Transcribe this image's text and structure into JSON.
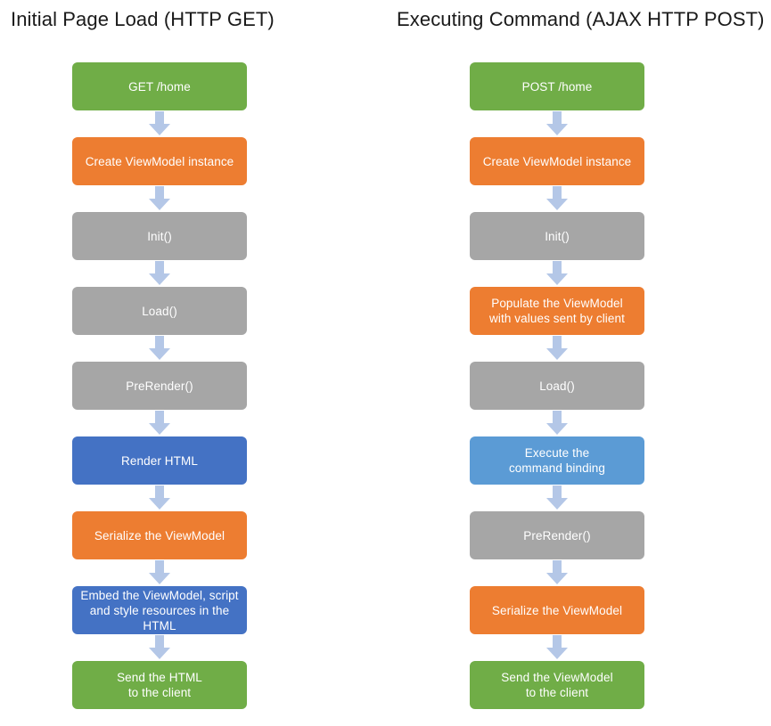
{
  "diagram": {
    "type": "flowchart",
    "orientation": "two-column vertical flow",
    "palette": {
      "green": "#70AD47",
      "orange": "#ED7D31",
      "gray": "#A6A6A6",
      "blue": "#4472C4",
      "light_blue": "#5B9BD5",
      "arrow": "#B4C7E7",
      "background": "#FFFFFF",
      "title_text": "#1A1A1A",
      "node_text": "#FFFFFF"
    },
    "arrow_icon_name": "down-arrow-icon"
  },
  "columns": [
    {
      "id": "initial-page-load",
      "title": "Initial Page Load (HTTP GET)",
      "nodes": [
        {
          "label": "GET /home",
          "color": "green"
        },
        {
          "label": "Create ViewModel instance",
          "color": "orange"
        },
        {
          "label": "Init()",
          "color": "gray"
        },
        {
          "label": "Load()",
          "color": "gray"
        },
        {
          "label": "PreRender()",
          "color": "gray"
        },
        {
          "label": "Render HTML",
          "color": "blue"
        },
        {
          "label": "Serialize the ViewModel",
          "color": "orange"
        },
        {
          "label": "Embed the ViewModel, script\nand style resources in the HTML",
          "color": "blue"
        },
        {
          "label": "Send the HTML\nto the client",
          "color": "green"
        }
      ]
    },
    {
      "id": "executing-command",
      "title": "Executing Command (AJAX HTTP POST)",
      "nodes": [
        {
          "label": "POST /home",
          "color": "green"
        },
        {
          "label": "Create ViewModel instance",
          "color": "orange"
        },
        {
          "label": "Init()",
          "color": "gray"
        },
        {
          "label": "Populate the ViewModel\nwith values sent by client",
          "color": "orange"
        },
        {
          "label": "Load()",
          "color": "gray"
        },
        {
          "label": "Execute the\ncommand binding",
          "color": "lightblue"
        },
        {
          "label": "PreRender()",
          "color": "gray"
        },
        {
          "label": "Serialize the ViewModel",
          "color": "orange"
        },
        {
          "label": "Send the ViewModel\nto the client",
          "color": "green"
        }
      ]
    }
  ]
}
